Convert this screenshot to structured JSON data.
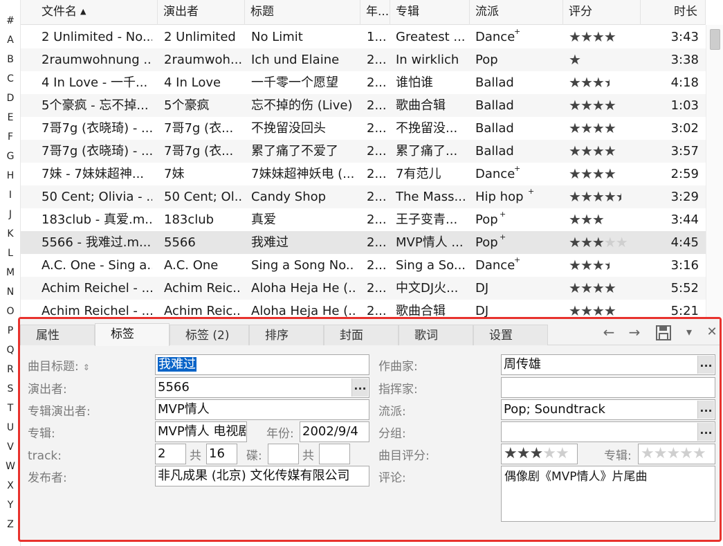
{
  "alphabet": [
    "#",
    "A",
    "B",
    "C",
    "D",
    "E",
    "F",
    "G",
    "H",
    "I",
    "J",
    "K",
    "L",
    "M",
    "N",
    "O",
    "P",
    "Q",
    "R",
    "S",
    "T",
    "U",
    "V",
    "W",
    "X",
    "Y",
    "Z"
  ],
  "columns": {
    "filename": "文件名",
    "artist": "演出者",
    "title": "标题",
    "year": "年...",
    "album": "专辑",
    "genre": "流派",
    "rating": "评分",
    "length": "时长"
  },
  "rows": [
    {
      "filename": "2 Unlimited - No...",
      "artist": "2 Unlimited",
      "title": "No Limit",
      "year": "1...",
      "album": "Greatest ...",
      "genre": "Dance",
      "genre_plus": "+",
      "rating": 4,
      "length": "3:43"
    },
    {
      "filename": "2raumwohnung ...",
      "artist": "2raumwoh...",
      "title": "Ich und Elaine",
      "year": "2...",
      "album": "In wirklich",
      "genre": "Pop",
      "genre_plus": "",
      "rating": 1,
      "length": "3:38"
    },
    {
      "filename": "4 In Love - 一千...",
      "artist": "4 In Love",
      "title": "一千零一个愿望",
      "year": "2...",
      "album": "谁怕谁",
      "genre": "Ballad",
      "genre_plus": "",
      "rating": 3.5,
      "length": "4:18"
    },
    {
      "filename": "5个豪疯 - 忘不掉...",
      "artist": "5个豪疯",
      "title": "忘不掉的伤 (Live)",
      "year": "2...",
      "album": "歌曲合辑",
      "genre": "Ballad",
      "genre_plus": "",
      "rating": 4,
      "length": "1:03"
    },
    {
      "filename": "7哥7g (衣晓琦) - ...",
      "artist": "7哥7g (衣...",
      "title": "不挽留没回头",
      "year": "2...",
      "album": "不挽留没...",
      "genre": "Ballad",
      "genre_plus": "",
      "rating": 4,
      "length": "3:02"
    },
    {
      "filename": "7哥7g (衣晓琦) - ...",
      "artist": "7哥7g (衣...",
      "title": "累了痛了不爱了",
      "year": "2...",
      "album": "累了痛了...",
      "genre": "Ballad",
      "genre_plus": "",
      "rating": 4,
      "length": "3:57"
    },
    {
      "filename": "7妹 - 7妹妹超神...",
      "artist": "7妹",
      "title": "7妹妹超神妖电 (...",
      "year": "2...",
      "album": "7有范儿",
      "genre": "Dance",
      "genre_plus": "+",
      "rating": 4,
      "length": "2:59"
    },
    {
      "filename": "50 Cent; Olivia - ...",
      "artist": "50 Cent; Ol...",
      "title": "Candy Shop",
      "year": "2...",
      "album": "The Mass...",
      "genre": "Hip hop",
      "genre_plus": "+",
      "rating": 4.5,
      "length": "3:29"
    },
    {
      "filename": "183club - 真爱.m...",
      "artist": "183club",
      "title": "真爱",
      "year": "2...",
      "album": "王子变青...",
      "genre": "Pop",
      "genre_plus": "+",
      "rating": 3,
      "length": "3:44"
    },
    {
      "filename": "5566 - 我难过.m...",
      "artist": "5566",
      "title": "我难过",
      "year": "2...",
      "album": "MVP情人 ...",
      "genre": "Pop",
      "genre_plus": "+",
      "rating": 3,
      "rating_max_shown": true,
      "length": "4:45"
    },
    {
      "filename": "A.C. One - Sing a...",
      "artist": "A.C. One",
      "title": "Sing a Song No...",
      "year": "2...",
      "album": "Sing a So...",
      "genre": "Dance",
      "genre_plus": "+",
      "rating": 3.5,
      "length": "3:16"
    },
    {
      "filename": "Achim Reichel - ...",
      "artist": "Achim Reic...",
      "title": "Aloha Heja He (...",
      "year": "2...",
      "album": "中文DJ火...",
      "genre": "DJ",
      "genre_plus": "",
      "rating": 4,
      "length": "5:52"
    },
    {
      "filename": "Achim Reichel - ...",
      "artist": "Achim Reic...",
      "title": "Aloha Heja He (...",
      "year": "2...",
      "album": "歌曲合辑",
      "genre": "DJ",
      "genre_plus": "",
      "rating": 4,
      "length": "5:21"
    }
  ],
  "selected_row": 9,
  "tabs": [
    "属性",
    "标签",
    "标签 (2)",
    "排序",
    "封面",
    "歌词",
    "设置"
  ],
  "active_tab": 1,
  "toolbar_icons": [
    "back-arrow-icon",
    "forward-arrow-icon",
    "save-icon",
    "dropdown-icon",
    "close-icon"
  ],
  "toolbar_glyphs": {
    "back": "←",
    "forward": "→",
    "save": "💾",
    "menu": "▾",
    "close": "✕"
  },
  "tag": {
    "title_label": "曲目标题:",
    "title_value": "我难过",
    "artist_label": "演出者:",
    "artist_value": "5566",
    "album_artist_label": "专辑演出者:",
    "album_artist_value": "MVP情人",
    "album_label": "专辑:",
    "album_value": "MVP情人 电视剧",
    "year_label": "年份:",
    "year_value": "2002/9/4",
    "track_label": "track:",
    "track_value": "2",
    "track_of_label": "共",
    "track_total": "16",
    "disc_label": "碟:",
    "disc_value": "",
    "disc_of_label": "共",
    "disc_total": "",
    "publisher_label": "发布者:",
    "publisher_value": "非凡成果 (北京) 文化传媒有限公司",
    "composer_label": "作曲家:",
    "composer_value": "周传雄",
    "conductor_label": "指挥家:",
    "conductor_value": "",
    "genre_label": "流派:",
    "genre_value": "Pop; Soundtrack",
    "grouping_label": "分组:",
    "grouping_value": "",
    "track_rating_label": "曲目评分:",
    "track_rating": 3,
    "album_rating_label": "专辑:",
    "album_rating": 0,
    "comment_label": "评论:",
    "comment_value": "偶像剧《MVP情人》片尾曲",
    "browse_button": "..."
  },
  "colors": {
    "highlight_border": "#e8322d",
    "selection": "#0a64c8"
  }
}
